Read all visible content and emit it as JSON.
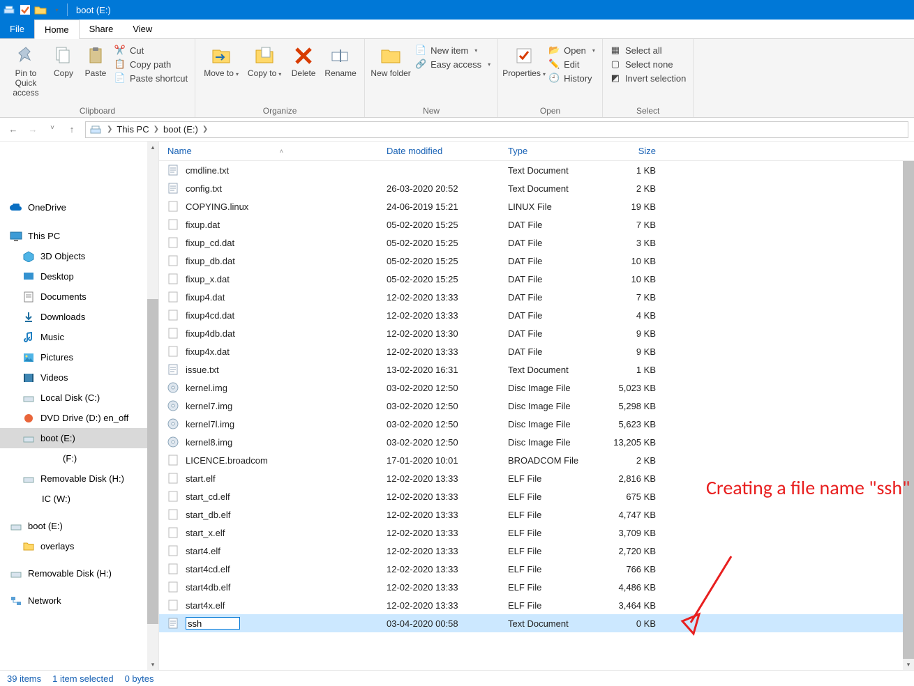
{
  "title": "boot (E:)",
  "tabs": {
    "file": "File",
    "home": "Home",
    "share": "Share",
    "view": "View"
  },
  "ribbon": {
    "pin": "Pin to Quick access",
    "copy": "Copy",
    "paste": "Paste",
    "cut": "Cut",
    "copypath": "Copy path",
    "pasteshort": "Paste shortcut",
    "clipboard": "Clipboard",
    "moveto": "Move to",
    "copyto": "Copy to",
    "delete": "Delete",
    "rename": "Rename",
    "organize": "Organize",
    "newfolder": "New folder",
    "newitem": "New item",
    "easyaccess": "Easy access",
    "new": "New",
    "properties": "Properties",
    "open": "Open",
    "edit": "Edit",
    "history": "History",
    "opengrp": "Open",
    "selectall": "Select all",
    "selectnone": "Select none",
    "invert": "Invert selection",
    "select": "Select"
  },
  "breadcrumb": {
    "thispc": "This PC",
    "boot": "boot (E:)"
  },
  "nav": {
    "onedrive": "OneDrive",
    "thispc": "This PC",
    "objs": "3D Objects",
    "desktop": "Desktop",
    "docs": "Documents",
    "down": "Downloads",
    "music": "Music",
    "pics": "Pictures",
    "vids": "Videos",
    "cdrive": "Local Disk (C:)",
    "dvd": "DVD Drive (D:) en_off",
    "boot": "boot (E:)",
    "fdrive": "(F:)",
    "remh": "Removable Disk (H:)",
    "icw": "IC (W:)",
    "boot2": "boot (E:)",
    "overlays": "overlays",
    "remh2": "Removable Disk (H:)",
    "network": "Network"
  },
  "columns": {
    "name": "Name",
    "dm": "Date modified",
    "ty": "Type",
    "sz": "Size"
  },
  "files": [
    {
      "n": "cmdline.txt",
      "d": "",
      "t": "Text Document",
      "s": "1 KB",
      "i": "txt"
    },
    {
      "n": "config.txt",
      "d": "26-03-2020 20:52",
      "t": "Text Document",
      "s": "2 KB",
      "i": "txt"
    },
    {
      "n": "COPYING.linux",
      "d": "24-06-2019 15:21",
      "t": "LINUX File",
      "s": "19 KB",
      "i": "gen"
    },
    {
      "n": "fixup.dat",
      "d": "05-02-2020 15:25",
      "t": "DAT File",
      "s": "7 KB",
      "i": "gen"
    },
    {
      "n": "fixup_cd.dat",
      "d": "05-02-2020 15:25",
      "t": "DAT File",
      "s": "3 KB",
      "i": "gen"
    },
    {
      "n": "fixup_db.dat",
      "d": "05-02-2020 15:25",
      "t": "DAT File",
      "s": "10 KB",
      "i": "gen"
    },
    {
      "n": "fixup_x.dat",
      "d": "05-02-2020 15:25",
      "t": "DAT File",
      "s": "10 KB",
      "i": "gen"
    },
    {
      "n": "fixup4.dat",
      "d": "12-02-2020 13:33",
      "t": "DAT File",
      "s": "7 KB",
      "i": "gen"
    },
    {
      "n": "fixup4cd.dat",
      "d": "12-02-2020 13:33",
      "t": "DAT File",
      "s": "4 KB",
      "i": "gen"
    },
    {
      "n": "fixup4db.dat",
      "d": "12-02-2020 13:30",
      "t": "DAT File",
      "s": "9 KB",
      "i": "gen"
    },
    {
      "n": "fixup4x.dat",
      "d": "12-02-2020 13:33",
      "t": "DAT File",
      "s": "9 KB",
      "i": "gen"
    },
    {
      "n": "issue.txt",
      "d": "13-02-2020 16:31",
      "t": "Text Document",
      "s": "1 KB",
      "i": "txt"
    },
    {
      "n": "kernel.img",
      "d": "03-02-2020 12:50",
      "t": "Disc Image File",
      "s": "5,023 KB",
      "i": "img"
    },
    {
      "n": "kernel7.img",
      "d": "03-02-2020 12:50",
      "t": "Disc Image File",
      "s": "5,298 KB",
      "i": "img"
    },
    {
      "n": "kernel7l.img",
      "d": "03-02-2020 12:50",
      "t": "Disc Image File",
      "s": "5,623 KB",
      "i": "img"
    },
    {
      "n": "kernel8.img",
      "d": "03-02-2020 12:50",
      "t": "Disc Image File",
      "s": "13,205 KB",
      "i": "img"
    },
    {
      "n": "LICENCE.broadcom",
      "d": "17-01-2020 10:01",
      "t": "BROADCOM File",
      "s": "2 KB",
      "i": "gen"
    },
    {
      "n": "start.elf",
      "d": "12-02-2020 13:33",
      "t": "ELF File",
      "s": "2,816 KB",
      "i": "gen"
    },
    {
      "n": "start_cd.elf",
      "d": "12-02-2020 13:33",
      "t": "ELF File",
      "s": "675 KB",
      "i": "gen"
    },
    {
      "n": "start_db.elf",
      "d": "12-02-2020 13:33",
      "t": "ELF File",
      "s": "4,747 KB",
      "i": "gen"
    },
    {
      "n": "start_x.elf",
      "d": "12-02-2020 13:33",
      "t": "ELF File",
      "s": "3,709 KB",
      "i": "gen"
    },
    {
      "n": "start4.elf",
      "d": "12-02-2020 13:33",
      "t": "ELF File",
      "s": "2,720 KB",
      "i": "gen"
    },
    {
      "n": "start4cd.elf",
      "d": "12-02-2020 13:33",
      "t": "ELF File",
      "s": "766 KB",
      "i": "gen"
    },
    {
      "n": "start4db.elf",
      "d": "12-02-2020 13:33",
      "t": "ELF File",
      "s": "4,486 KB",
      "i": "gen"
    },
    {
      "n": "start4x.elf",
      "d": "12-02-2020 13:33",
      "t": "ELF File",
      "s": "3,464 KB",
      "i": "gen"
    },
    {
      "n": "ssh",
      "d": "03-04-2020 00:58",
      "t": "Text Document",
      "s": "0 KB",
      "i": "txt",
      "editing": true
    }
  ],
  "status": {
    "count": "39 items",
    "sel": "1 item selected",
    "bytes": "0 bytes"
  },
  "annotation": "Creating a file name \"ssh\""
}
